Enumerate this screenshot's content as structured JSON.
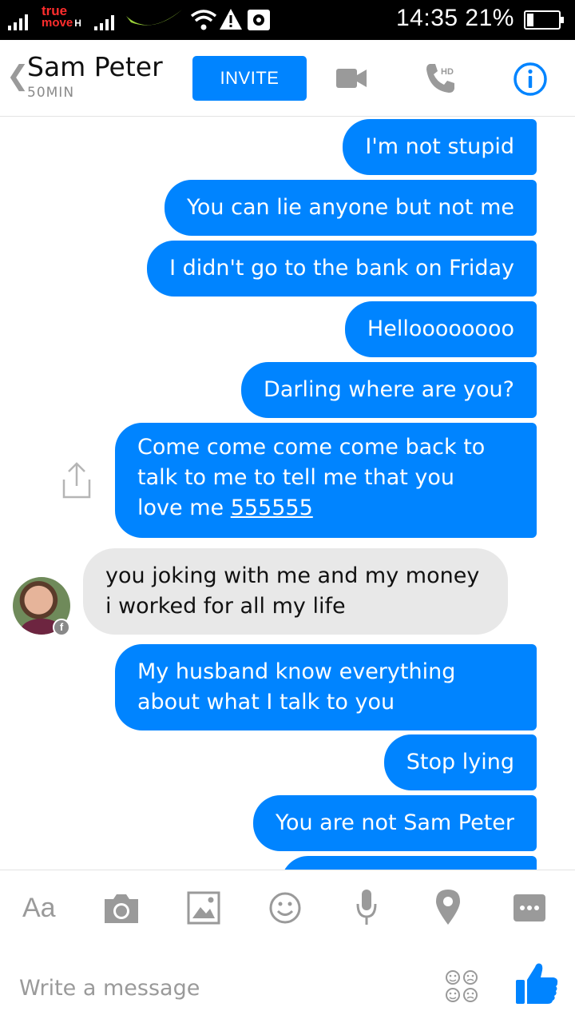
{
  "status_bar": {
    "carrier_line1": "true",
    "carrier_line2": "move",
    "network_type": "H",
    "time": "14:35",
    "battery_percent": "21%",
    "battery_level": 0.21
  },
  "header": {
    "contact_name": "Sam Peter",
    "last_seen": "50MIN",
    "invite_label": "INVITE",
    "icons": [
      "back-chevron-icon",
      "video-camera-icon",
      "hd-phone-icon",
      "info-icon"
    ],
    "accent_color": "#0084ff"
  },
  "messages": [
    {
      "sender": "me",
      "text": "I'm not stupid"
    },
    {
      "sender": "me",
      "text": "You can lie anyone but not me"
    },
    {
      "sender": "me",
      "text": "I didn't go to the bank on Friday"
    },
    {
      "sender": "me",
      "text": "Helloooooooo"
    },
    {
      "sender": "me",
      "text": "Darling where are you?"
    },
    {
      "sender": "me",
      "lines": [
        "Come come come come back to",
        "talk to me to tell me that you",
        "love me "
      ],
      "link": "555555"
    },
    {
      "sender": "them",
      "lines": [
        "you joking with me and my money",
        "i worked for all my life"
      ]
    },
    {
      "sender": "me",
      "lines": [
        "My husband know everything",
        "about what I talk to you"
      ]
    },
    {
      "sender": "me",
      "text": "Stop lying"
    },
    {
      "sender": "me",
      "text": "You are not Sam Peter"
    }
  ],
  "composer": {
    "text_format_label": "Aa",
    "tools": [
      "camera-icon",
      "gallery-icon",
      "emoji-icon",
      "microphone-icon",
      "location-icon",
      "more-icon"
    ],
    "placeholder": "Write a message",
    "sticker_icon": "sticker-icon",
    "like_icon": "thumbs-up-icon"
  }
}
